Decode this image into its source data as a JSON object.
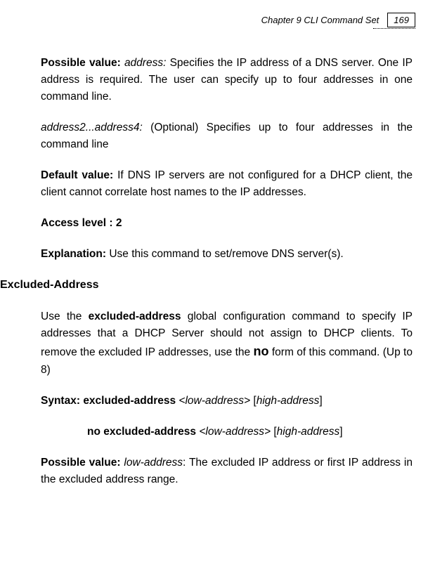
{
  "header": {
    "chapter": "Chapter 9 CLI Command Set",
    "page": "169"
  },
  "p1": {
    "label": "Possible value: ",
    "italic1": "address:",
    "text": " Specifies the IP address of a DNS server. One IP address is required. The user can specify up to four addresses in one command line."
  },
  "p2": {
    "italic": "address2...address4:",
    "text": " (Optional) Specifies up to four addresses in the command line"
  },
  "p3": {
    "label": "Default value:",
    "text": " If DNS IP servers are not configured for a DHCP client, the client cannot correlate host names to the IP addresses."
  },
  "p4": {
    "text": "Access level : 2"
  },
  "p5": {
    "label": "Explanation:",
    "text": " Use this command to set/remove DNS server(s)."
  },
  "section": {
    "heading": "Excluded-Address"
  },
  "p6": {
    "t1": "Use the ",
    "b1": "excluded-address",
    "t2": " global configuration command to specify IP addresses that a DHCP Server should not assign to DHCP clients. To remove the excluded IP addresses, use the ",
    "no": "no",
    "t3": " form of this command. (Up to 8)"
  },
  "p7": {
    "label": "Syntax:  ",
    "b1": "excluded-address ",
    "i1": "<low-address> ",
    "t1": "[",
    "i2": "high-address",
    "t2": "]"
  },
  "p8": {
    "b1": "no excluded-address ",
    "i1": "<low-address> ",
    "t1": "[",
    "i2": "high-address",
    "t2": "]"
  },
  "p9": {
    "label": "Possible value: ",
    "i1": "low-address",
    "t1": ": The excluded IP address or first IP address in the excluded address range."
  }
}
